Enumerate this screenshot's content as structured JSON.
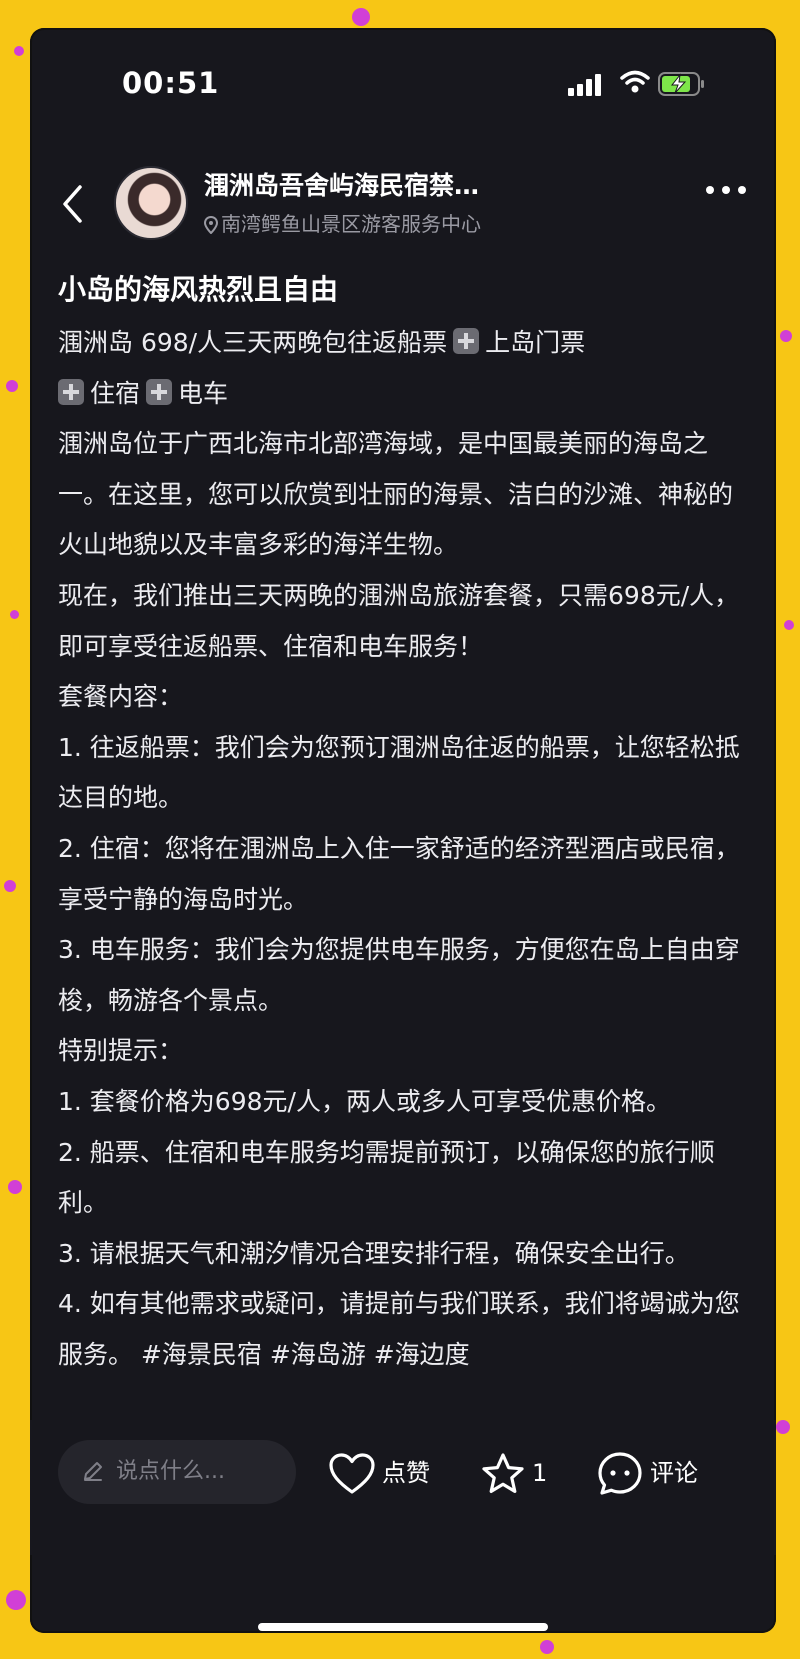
{
  "status_bar": {
    "time": "00:51"
  },
  "header": {
    "author": "涠洲岛吾舍屿海民宿禁…",
    "location": "南湾鳄鱼山景区游客服务中心"
  },
  "post": {
    "title": "小岛的海风热烈且自由",
    "line1_a": "涠洲岛 698/人三天两晚包往返船票",
    "line1_b": "上岛门票",
    "line1_c": "住宿",
    "line1_d": "电车",
    "paragraphs": [
      "涠洲岛位于广西北海市北部湾海域，是中国最美丽的海岛之一。在这里，您可以欣赏到壮丽的海景、洁白的沙滩、神秘的火山地貌以及丰富多彩的海洋生物。",
      "现在，我们推出三天两晚的涠洲岛旅游套餐，只需698元/人，即可享受往返船票、住宿和电车服务！",
      "套餐内容：",
      "1. 往返船票：我们会为您预订涠洲岛往返的船票，让您轻松抵达目的地。",
      "2. 住宿：您将在涠洲岛上入住一家舒适的经济型酒店或民宿，享受宁静的海岛时光。",
      "3. 电车服务：我们会为您提供电车服务，方便您在岛上自由穿梭，畅游各个景点。",
      "特别提示：",
      "1. 套餐价格为698元/人，两人或多人可享受优惠价格。",
      "2. 船票、住宿和电车服务均需提前预订，以确保您的旅行顺利。",
      "3. 请根据天气和潮汐情况合理安排行程，确保安全出行。",
      "4. 如有其他需求或疑问，请提前与我们联系，我们将竭诚为您服务。 #海景民宿 #海岛游 #海边度"
    ]
  },
  "bottom_bar": {
    "comment_placeholder": "说点什么...",
    "like_label": "点赞",
    "collect_count": "1",
    "comment_label": "评论"
  },
  "icons": {
    "back": "chevron-left-icon",
    "more": "more-dots-icon",
    "location": "location-pin-icon",
    "like": "heart-icon",
    "collect": "star-icon",
    "comment": "chat-bubble-icon",
    "edit": "pencil-icon"
  },
  "colors": {
    "border_background": "#f7c615",
    "confetti": "#d13fd6",
    "app_background": "#17171d",
    "battery_charging": "#7ee64a"
  }
}
